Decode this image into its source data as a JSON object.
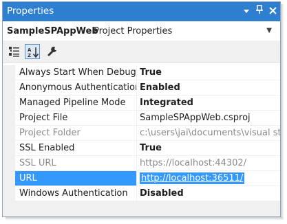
{
  "panel": {
    "title": "Properties",
    "controls": {
      "dropdown_icon": "dropdown-arrow-icon",
      "pin_icon": "pin-icon",
      "close_icon": "close-icon"
    }
  },
  "object_selector": {
    "name": "SampleSPAppWeb",
    "type": "Project Properties"
  },
  "toolbar": {
    "buttons": [
      {
        "name": "categorized-icon",
        "pressed": false
      },
      {
        "name": "alphabetical-icon",
        "pressed": true
      },
      {
        "name": "property-pages-icon",
        "pressed": false
      }
    ]
  },
  "properties": [
    {
      "name": "Always Start When Debugging",
      "value": "True",
      "bold": true,
      "readonly": false
    },
    {
      "name": "Anonymous Authentication",
      "value": "Enabled",
      "bold": true,
      "readonly": false
    },
    {
      "name": "Managed Pipeline Mode",
      "value": "Integrated",
      "bold": true,
      "readonly": false
    },
    {
      "name": "Project File",
      "value": "SampleSPAppWeb.csproj",
      "bold": false,
      "readonly": false
    },
    {
      "name": "Project Folder",
      "value": "c:\\users\\jai\\documents\\visual studio",
      "bold": false,
      "readonly": true
    },
    {
      "name": "SSL Enabled",
      "value": "True",
      "bold": true,
      "readonly": false
    },
    {
      "name": "SSL URL",
      "value": "https://localhost:44302/",
      "bold": false,
      "readonly": true
    },
    {
      "name": "URL",
      "value": "http://localhost:36511/",
      "bold": false,
      "readonly": true,
      "selected": true
    },
    {
      "name": "Windows Authentication",
      "value": "Disabled",
      "bold": true,
      "readonly": false
    }
  ],
  "colors": {
    "titlebar": "#2f7fd1",
    "selection": "#3399ff",
    "readonly_text": "#8a8a8a"
  }
}
